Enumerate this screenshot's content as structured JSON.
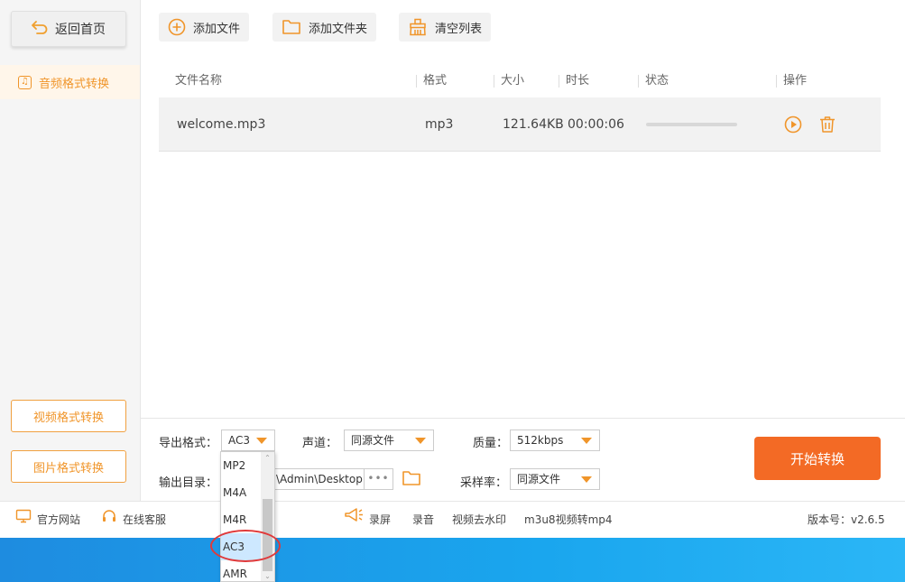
{
  "sidebar": {
    "home_label": "返回首页",
    "active_label": "音频格式转换",
    "video_label": "视频格式转换",
    "image_label": "图片格式转换"
  },
  "toolbar": {
    "add_file": "添加文件",
    "add_folder": "添加文件夹",
    "clear_list": "清空列表"
  },
  "table": {
    "headers": [
      "文件名称",
      "格式",
      "大小",
      "时长",
      "状态",
      "操作"
    ],
    "rows": [
      {
        "name": "welcome.mp3",
        "format": "mp3",
        "size": "121.64KB",
        "duration": "00:00:06",
        "progress": 0
      }
    ]
  },
  "settings": {
    "format_label": "导出格式：",
    "format_value": "AC3",
    "channel_label": "声道：",
    "channel_value": "同源文件",
    "quality_label": "质量：",
    "quality_value": "512kbps",
    "output_label": "输出目录：",
    "output_value": "\\Admin\\Desktop'",
    "output_more": "•••",
    "samplerate_label": "采样率：",
    "samplerate_value": "同源文件",
    "start_label": "开始转换"
  },
  "dropdown": {
    "options": [
      "MP2",
      "M4A",
      "M4R",
      "AC3",
      "AMR"
    ],
    "selected": "AC3"
  },
  "statusbar": {
    "website": "官方网站",
    "service": "在线客服",
    "record_screen": "录屏",
    "record_audio": "录音",
    "watermark": "视频去水印",
    "m3u8": "m3u8视频转mp4",
    "version": "版本号：v2.6.5"
  },
  "colors": {
    "accent": "#f0952a",
    "start_button": "#f36a25",
    "desktop": "#1aa6ee"
  }
}
